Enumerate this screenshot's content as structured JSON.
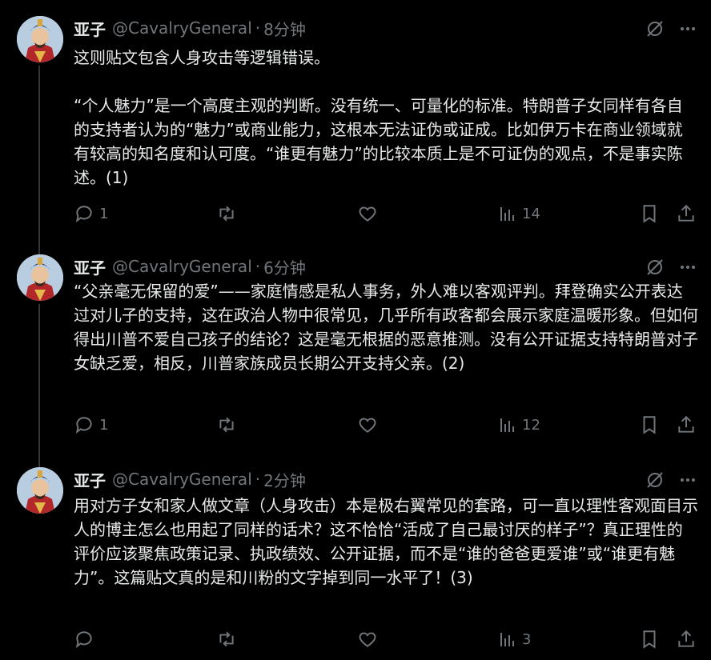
{
  "tweets": [
    {
      "name": "亚子",
      "handle": "@CavalryGeneral",
      "sep": "·",
      "time": "8分钟",
      "text": "这则贴文包含人身攻击等逻辑错误。\n\n“个人魅力”是一个高度主观的判断。没有统一、可量化的标准。特朗普子女同样有各自的支持者认为的“魅力”或商业能力，这根本无法证伪或证成。比如伊万卡在商业领域就有较高的知名度和认可度。“谁更有魅力”的比较本质上是不可证伪的观点，不是事实陈述。(1)",
      "replies": "1",
      "views": "14"
    },
    {
      "name": "亚子",
      "handle": "@CavalryGeneral",
      "sep": "·",
      "time": "6分钟",
      "text": "“父亲毫无保留的爱”——家庭情感是私人事务，外人难以客观评判。拜登确实公开表达过对儿子的支持，这在政治人物中很常见，几乎所有政客都会展示家庭温暖形象。但如何得出川普不爱自己孩子的结论？这是毫无根据的恶意推测。没有公开证据支持特朗普对子女缺乏爱，相反，川普家族成员长期公开支持父亲。(2)",
      "replies": "1",
      "views": "12"
    },
    {
      "name": "亚子",
      "handle": "@CavalryGeneral",
      "sep": "·",
      "time": "2分钟",
      "text": "用对方子女和家人做文章（人身攻击）本是极右翼常见的套路，可一直以理性客观面目示人的博主怎么也用起了同样的话术？这不恰恰“活成了自己最讨厌的样子”？真正理性的评价应该聚焦政策记录、执政绩效、公开证据，而不是“谁的爸爸更爱谁”或“谁更有魅力”。这篇贴文真的是和川粉的文字掉到同一水平了！(3)",
      "replies": "",
      "views": "3"
    }
  ],
  "icons": {
    "grok": "grok-slash-circle-icon",
    "more": "more-dots-icon",
    "reply": "reply-bubble-icon",
    "retweet": "retweet-icon",
    "like": "heart-icon",
    "views": "views-bars-icon",
    "bookmark": "bookmark-icon",
    "share": "share-upload-icon"
  },
  "colors": {
    "background": "#000000",
    "text": "#e7e9ea",
    "muted": "#71767b",
    "thread_line": "#333639"
  }
}
